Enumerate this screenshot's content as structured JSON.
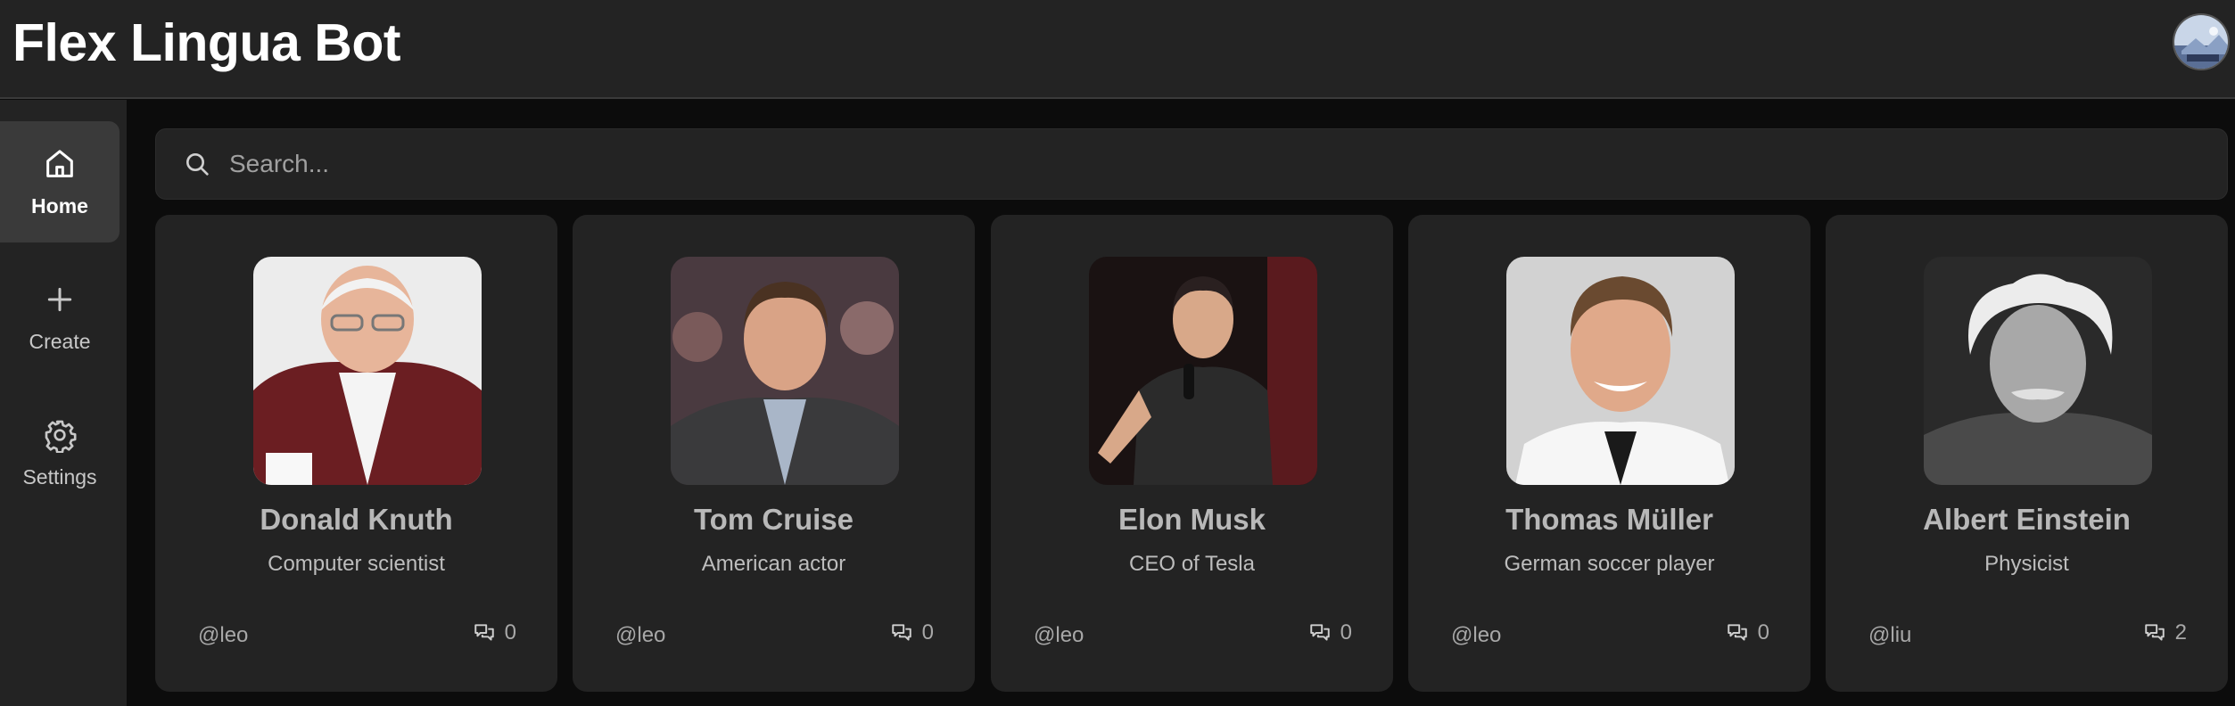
{
  "app": {
    "title": "Flex Lingua Bot"
  },
  "sidebar": {
    "items": [
      {
        "label": "Home",
        "icon": "home-icon",
        "active": true
      },
      {
        "label": "Create",
        "icon": "plus-icon",
        "active": false
      },
      {
        "label": "Settings",
        "icon": "gear-icon",
        "active": false
      }
    ]
  },
  "search": {
    "placeholder": "Search...",
    "value": ""
  },
  "cards": [
    {
      "name": "Donald Knuth",
      "description": "Computer scientist",
      "author": "@leo",
      "count": "0"
    },
    {
      "name": "Tom Cruise",
      "description": "American actor",
      "author": "@leo",
      "count": "0"
    },
    {
      "name": "Elon Musk",
      "description": "CEO of Tesla",
      "author": "@leo",
      "count": "0"
    },
    {
      "name": "Thomas Müller",
      "description": "German soccer player",
      "author": "@leo",
      "count": "0"
    },
    {
      "name": "Albert Einstein",
      "description": "Physicist",
      "author": "@liu",
      "count": "2"
    }
  ],
  "colors": {
    "header_bg": "#232323",
    "page_bg": "#0c0c0c",
    "card_bg": "#232323",
    "active_nav_bg": "#3a3a3a"
  }
}
